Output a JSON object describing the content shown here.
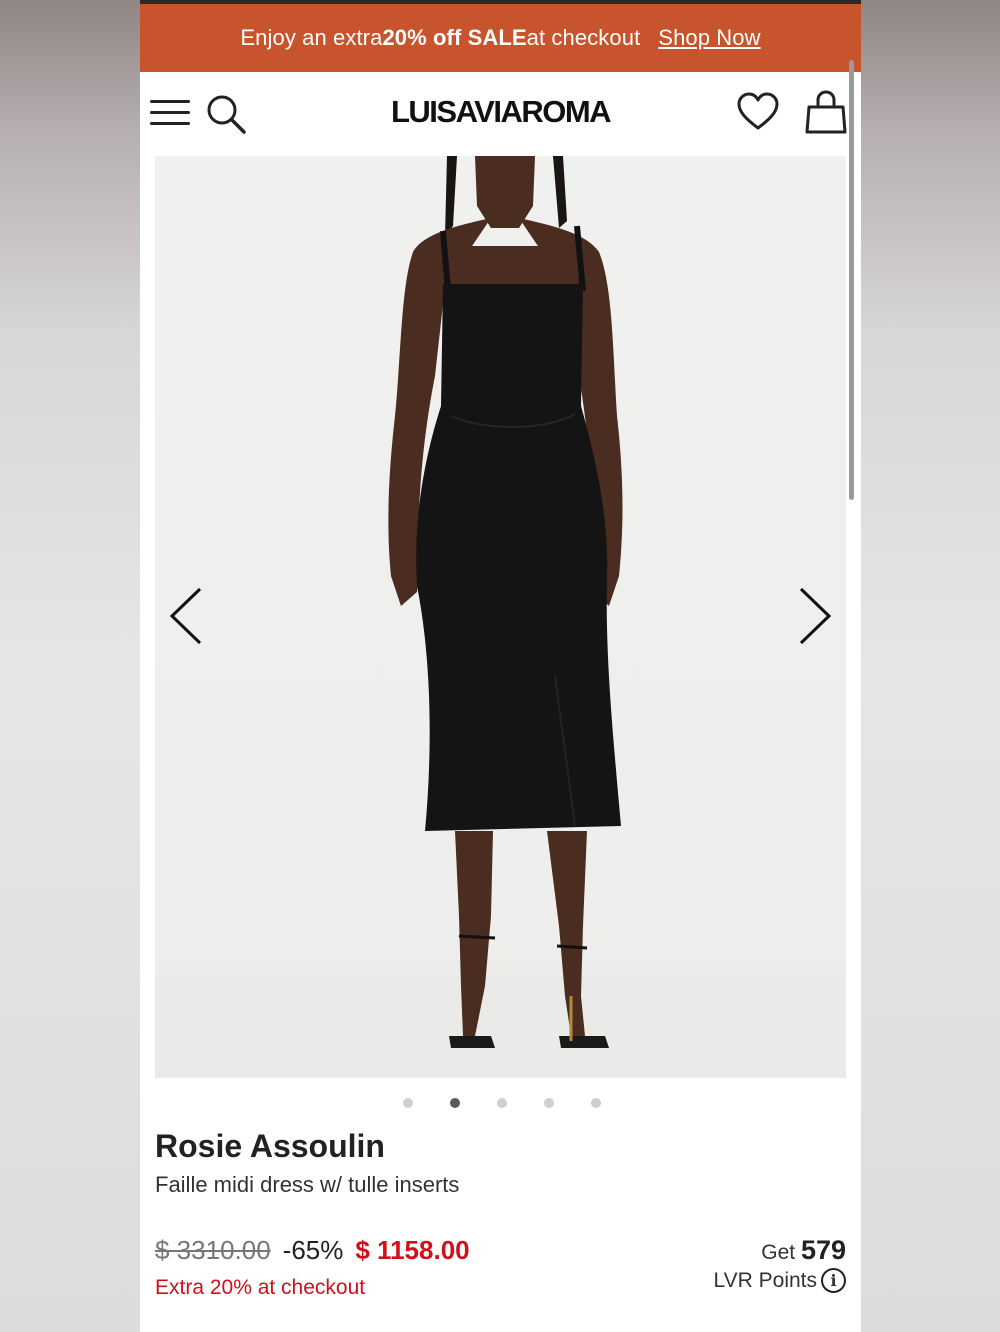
{
  "banner": {
    "pre": "Enjoy an extra ",
    "bold1": "20% off SALE",
    "post": " at checkout",
    "link": "Shop Now"
  },
  "header": {
    "logo": "LUISAVIAROMA",
    "icons": [
      "menu-icon",
      "search-icon",
      "heart-icon",
      "bag-icon"
    ]
  },
  "gallery": {
    "image_count": 5,
    "active_index": 1
  },
  "product": {
    "brand": "Rosie Assoulin",
    "name": "Faille midi dress w/ tulle inserts",
    "old_price": "$ 3310.00",
    "discount": "-65%",
    "price": "$ 1158.00",
    "extra": "Extra 20% at checkout"
  },
  "points": {
    "get": "Get",
    "value": "579",
    "label": "LVR Points",
    "info": "i"
  },
  "colors": {
    "banner": "#c8542d",
    "sale_red": "#d0101a"
  }
}
